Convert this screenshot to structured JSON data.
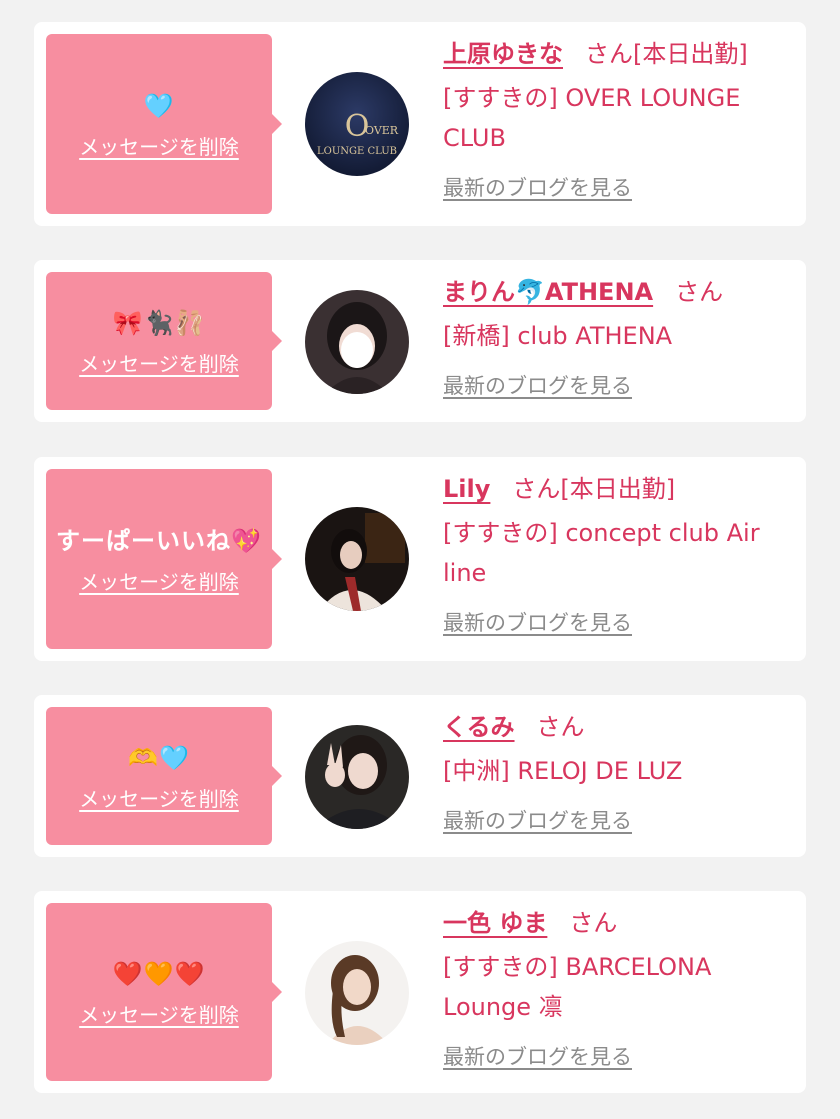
{
  "common": {
    "delete_label": "メッセージを削除",
    "honorific": "さん",
    "blog_label": "最新のブログを見る"
  },
  "colors": {
    "accent": "#d8365e",
    "bubble": "#f78ea0",
    "background": "#f2f2f2",
    "link_gray": "#8b8b8b"
  },
  "items": [
    {
      "message": "🩵",
      "name": "上原ゆきな",
      "status": "[本日出勤]",
      "workplace": "[すすきの] OVER LOUNGE CLUB",
      "avatar": {
        "kind": "logo",
        "logo_text_1": "OVER",
        "logo_text_2": "LOUNGE CLUB"
      }
    },
    {
      "message": "🎀🐈‍⬛🩰",
      "name": "まりん🐬ATHENA",
      "status": "",
      "workplace": "[新橋] club ATHENA",
      "avatar": {
        "kind": "photo"
      }
    },
    {
      "message": "すーぱーいいね💖",
      "name": "Lily",
      "status": "[本日出勤]",
      "workplace": "[すすきの] concept club Air line",
      "avatar": {
        "kind": "photo"
      }
    },
    {
      "message": "🫶🩵",
      "name": "くるみ",
      "status": "",
      "workplace": "[中洲] RELOJ DE LUZ",
      "avatar": {
        "kind": "photo"
      }
    },
    {
      "message": "❤️🧡❤️",
      "name": "一色 ゆま",
      "status": "",
      "workplace": "[すすきの] BARCELONA Lounge 凛",
      "avatar": {
        "kind": "photo"
      }
    }
  ]
}
